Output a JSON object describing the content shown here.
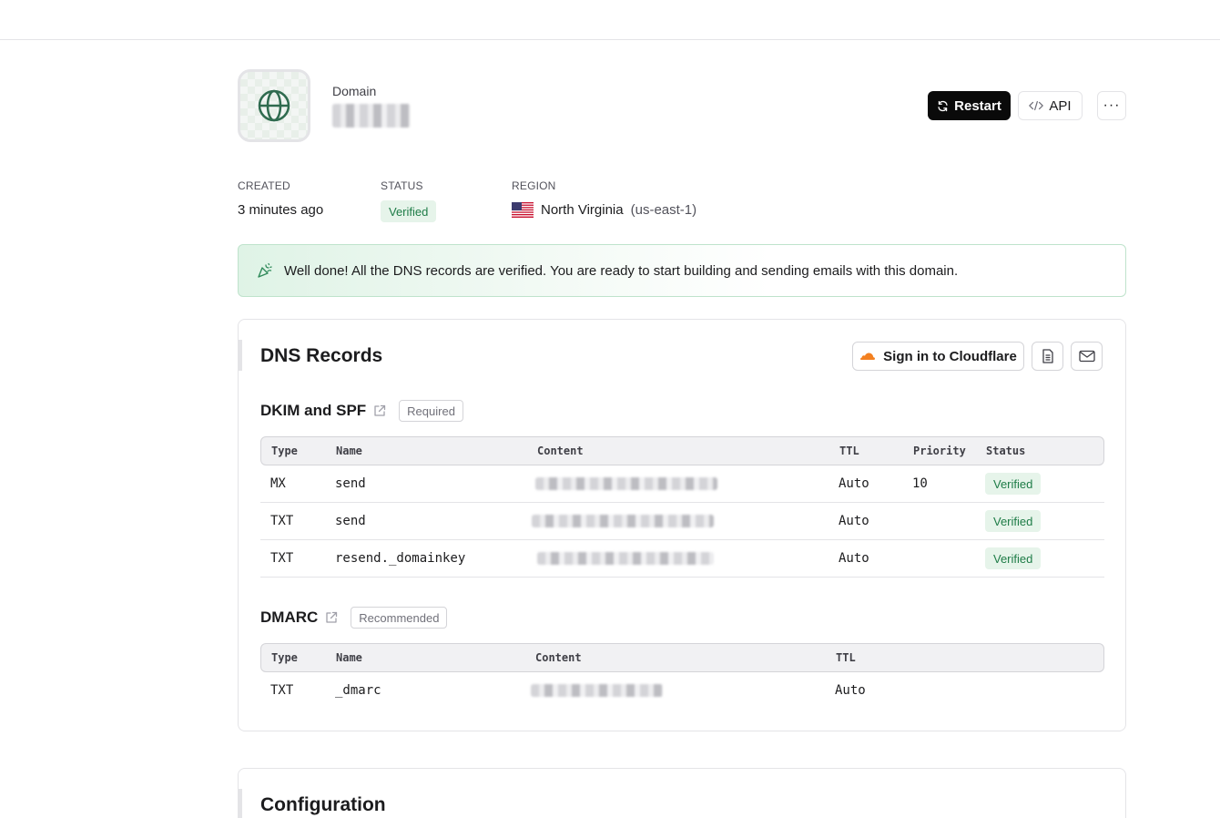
{
  "header": {
    "domain_label": "Domain",
    "actions": {
      "restart": "Restart",
      "api": "API",
      "more": "···"
    }
  },
  "meta": {
    "created_label": "CREATED",
    "created_value": "3 minutes ago",
    "status_label": "STATUS",
    "status_value": "Verified",
    "region_label": "REGION",
    "region_name": "North Virginia",
    "region_code": "(us-east-1)"
  },
  "banner": {
    "text": "Well done! All the DNS records are verified. You are ready to start building and sending emails with this domain."
  },
  "dns": {
    "title": "DNS Records",
    "cloudflare_button": "Sign in to Cloudflare",
    "dkim_spf": {
      "title": "DKIM and SPF",
      "tag": "Required",
      "columns": [
        "Type",
        "Name",
        "Content",
        "TTL",
        "Priority",
        "Status"
      ],
      "rows": [
        {
          "type": "MX",
          "name": "send",
          "ttl": "Auto",
          "priority": "10",
          "status": "Verified"
        },
        {
          "type": "TXT",
          "name": "send",
          "ttl": "Auto",
          "priority": "",
          "status": "Verified"
        },
        {
          "type": "TXT",
          "name": "resend._domainkey",
          "ttl": "Auto",
          "priority": "",
          "status": "Verified"
        }
      ]
    },
    "dmarc": {
      "title": "DMARC",
      "tag": "Recommended",
      "columns": [
        "Type",
        "Name",
        "Content",
        "TTL"
      ],
      "rows": [
        {
          "type": "TXT",
          "name": "_dmarc",
          "ttl": "Auto"
        }
      ]
    }
  },
  "configuration": {
    "title": "Configuration"
  },
  "colors": {
    "accent_green": "#1e7c47",
    "badge_green_bg": "#e6f4ea",
    "cloudflare_orange": "#f38020",
    "primary_button": "#0a0a0a"
  },
  "icons": {
    "domain": "globe-icon",
    "restart": "refresh-icon",
    "api": "code-icon",
    "banner": "party-popper-icon",
    "external": "external-link-icon",
    "docs": "document-icon",
    "email": "mail-icon",
    "flag": "us-flag-icon"
  }
}
